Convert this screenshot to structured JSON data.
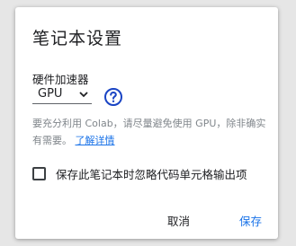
{
  "dialog": {
    "title": "笔记本设置",
    "accelerator": {
      "label": "硬件加速器",
      "selected": "GPU"
    },
    "note": {
      "text": "要充分利用 Colab，请尽量避免使用 GPU，除非确实有需要。",
      "link": "了解详情"
    },
    "checkbox": {
      "label": "保存此笔记本时忽略代码单元格输出项",
      "checked": false
    },
    "buttons": {
      "cancel": "取消",
      "save": "保存"
    }
  },
  "colors": {
    "accent": "#1a73e8",
    "help_icon": "#1a44c4"
  },
  "icons": {
    "dropdown": "chevron-down-icon",
    "help": "help-circle-icon"
  }
}
